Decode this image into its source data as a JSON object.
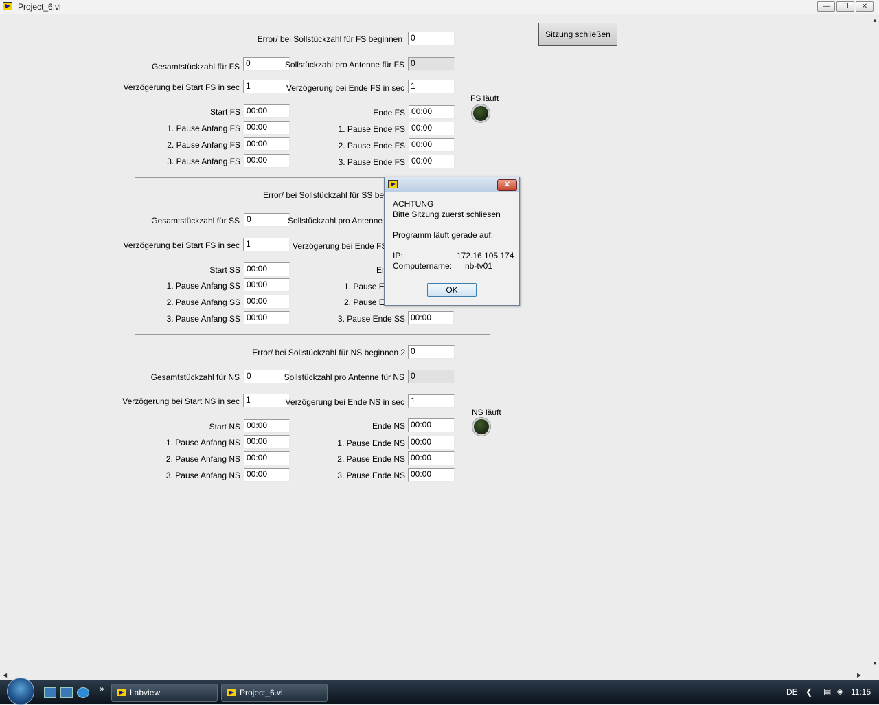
{
  "window": {
    "title": "Project_6.vi",
    "controls": [
      "minimize",
      "maximize",
      "close"
    ]
  },
  "close_session_button": "Sitzung schließen",
  "fs": {
    "error_label": "Error/ bei Sollstückzahl für FS beginnen",
    "error_value": "0",
    "total_label": "Gesamtstückzahl für FS",
    "total_value": "0",
    "per_antenna_label": "Sollstückzahl pro Antenne für FS",
    "per_antenna_value": "0",
    "delay_start_label": "Verzögerung bei Start FS in sec",
    "delay_start_value": "1",
    "delay_end_label": "Verzögerung bei Ende FS in sec",
    "delay_end_value": "1",
    "running_label": "FS läuft",
    "start_label": "Start FS",
    "start_value": "00:00",
    "end_label": "Ende FS",
    "end_value": "00:00",
    "p1_start_label": "1. Pause Anfang FS",
    "p1_start_value": "00:00",
    "p2_start_label": "2. Pause Anfang FS",
    "p2_start_value": "00:00",
    "p3_start_label": "3. Pause Anfang FS",
    "p3_start_value": "00:00",
    "p1_end_label": "1. Pause Ende FS",
    "p1_end_value": "00:00",
    "p2_end_label": "2. Pause Ende FS",
    "p2_end_value": "00:00",
    "p3_end_label": "3. Pause Ende FS",
    "p3_end_value": "00:00"
  },
  "ss": {
    "error_label": "Error/ bei Sollstückzahl für SS beg",
    "total_label": "Gesamtstückzahl für SS",
    "total_value": "0",
    "per_antenna_label": "Sollstückzahl pro Antenne",
    "delay_start_label": "Verzögerung bei Start FS in sec",
    "delay_start_value": "1",
    "delay_end_label": "Verzögerung bei Ende FS",
    "start_label": "Start SS",
    "start_value": "00:00",
    "end_label": "En",
    "p1_start_label": "1. Pause Anfang SS",
    "p1_start_value": "00:00",
    "p2_start_label": "2. Pause Anfang SS",
    "p2_start_value": "00:00",
    "p3_start_label": "3. Pause Anfang SS",
    "p3_start_value": "00:00",
    "p1_end_label": "1. Pause Er",
    "p2_end_label": "2. Pause Er",
    "p3_end_label": "3. Pause Ende SS",
    "p3_end_value": "00:00"
  },
  "ns": {
    "error_label": "Error/ bei Sollstückzahl für NS beginnen 2",
    "error_value": "0",
    "total_label": "Gesamtstückzahl für NS",
    "total_value": "0",
    "per_antenna_label": "Sollstückzahl pro Antenne für NS",
    "per_antenna_value": "0",
    "delay_start_label": "Verzögerung bei Start NS in sec",
    "delay_start_value": "1",
    "delay_end_label": "Verzögerung bei Ende NS in sec",
    "delay_end_value": "1",
    "running_label": "NS läuft",
    "start_label": "Start NS",
    "start_value": "00:00",
    "end_label": "Ende NS",
    "end_value": "00:00",
    "p1_start_label": "1. Pause Anfang NS",
    "p1_start_value": "00:00",
    "p2_start_label": "2. Pause Anfang NS",
    "p2_start_value": "00:00",
    "p3_start_label": "3. Pause Anfang NS",
    "p3_start_value": "00:00",
    "p1_end_label": "1. Pause Ende NS",
    "p1_end_value": "00:00",
    "p2_end_label": "2. Pause Ende NS",
    "p2_end_value": "00:00",
    "p3_end_label": "3. Pause Ende NS",
    "p3_end_value": "00:00"
  },
  "dialog": {
    "heading": "ACHTUNG",
    "message": "Bitte Sitzung zuerst schliesen",
    "running_on": "Programm läuft gerade auf:",
    "ip_label": "IP:",
    "ip_value": "172.16.105.174",
    "computer_label": "Computername:",
    "computer_value": "nb-tv01",
    "ok_label": "OK"
  },
  "taskbar": {
    "buttons": [
      "Labview",
      "Project_6.vi"
    ],
    "language": "DE",
    "clock": "11:15",
    "quicklaunch_overflow": "»"
  }
}
